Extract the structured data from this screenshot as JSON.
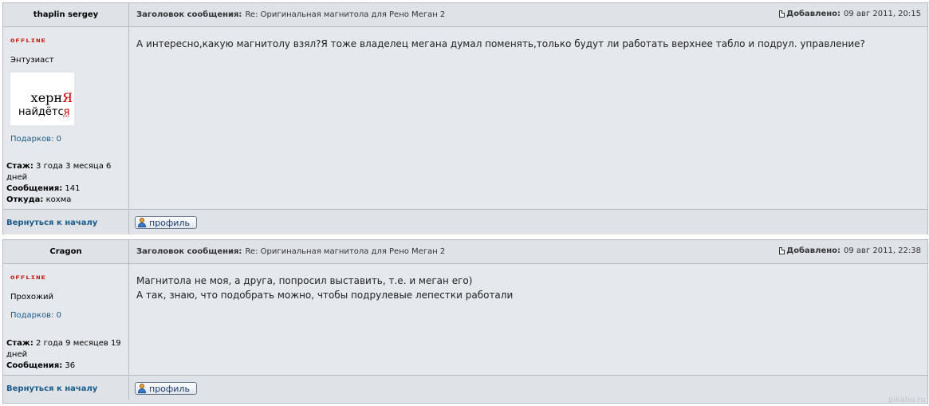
{
  "posts": [
    {
      "author": "thaplin sergey",
      "subject_label": "Заголовок сообщения:",
      "subject": "Re: Оригинальная магнитола для Рено Меган 2",
      "added_label": "Добавлено:",
      "added": "09 авг 2011, 20:15",
      "status": "OFFLINE",
      "rank": "Энтузиаст",
      "avatar_line1": "херн",
      "avatar_line1_red": "Я",
      "avatar_line2": "найдётс",
      "avatar_line2_red": "я",
      "gifts": "Подарков: 0",
      "stats": [
        {
          "label": "Стаж:",
          "value": "3 года 3 месяца 6 дней"
        },
        {
          "label": "Сообщения:",
          "value": "141"
        },
        {
          "label": "Откуда:",
          "value": "кохма"
        }
      ],
      "message": [
        "А интересно,какую магнитолу взял?Я тоже владелец мегана думал поменять,только будут ли работать верхнее табло и подрул. управление?"
      ],
      "back": "Вернуться к началу",
      "profile": "профиль"
    },
    {
      "author": "Cragon",
      "subject_label": "Заголовок сообщения:",
      "subject": "Re: Оригинальная магнитола для Рено Меган 2",
      "added_label": "Добавлено:",
      "added": "09 авг 2011, 22:38",
      "status": "OFFLINE",
      "rank": "Прохожий",
      "gifts": "Подарков: 0",
      "stats": [
        {
          "label": "Стаж:",
          "value": "2 года 9 месяцев 19 дней"
        },
        {
          "label": "Сообщения:",
          "value": "36"
        }
      ],
      "message": [
        "Магнитола не моя, а друга, попросил выставить, т.е. и меган его)",
        "А так, знаю, что подобрать можно, чтобы подрулевые лепестки работали"
      ],
      "back": "Вернуться к началу",
      "profile": "профиль"
    }
  ],
  "watermark": "pikabu.ru",
  "colors": {
    "link": "#1a5a8a",
    "offline": "#cc0000",
    "header_bg": "#dfe3e8",
    "body_bg": "#e5e8ec",
    "border": "#b4bac0"
  }
}
